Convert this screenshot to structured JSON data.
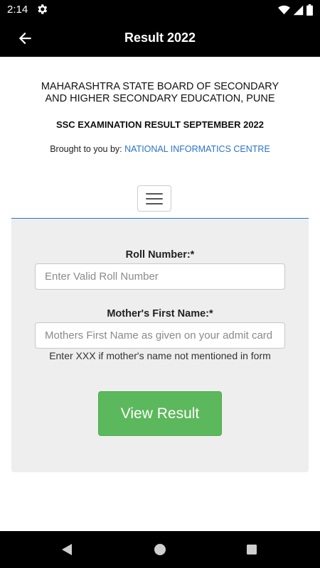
{
  "status_bar": {
    "time": "2:14",
    "icons": [
      "gear-icon",
      "wifi-icon",
      "cellular-signal-icon",
      "battery-icon"
    ]
  },
  "app_bar": {
    "title": "Result 2022",
    "back_icon": "arrow-left-icon"
  },
  "header": {
    "board_line1": "MAHARASHTRA STATE BOARD OF SECONDARY",
    "board_line2": "AND HIGHER SECONDARY EDUCATION, PUNE",
    "exam_title": "SSC EXAMINATION RESULT SEPTEMBER 2022",
    "credit_prefix": "Brought to you by:",
    "credit_link": "NATIONAL INFORMATICS CENTRE"
  },
  "menu": {
    "icon": "hamburger-menu-icon"
  },
  "form": {
    "roll_label": "Roll Number:*",
    "roll_value": "",
    "roll_placeholder": "Enter Valid Roll Number",
    "mother_label": "Mother's First Name:*",
    "mother_value": "",
    "mother_placeholder": "Mothers First Name as given on your admit card",
    "mother_hint": "Enter XXX if mother's name not mentioned in form",
    "submit_label": "View Result"
  },
  "colors": {
    "app_bar": "#000000",
    "link": "#2a73c9",
    "panel": "#eeeeee",
    "submit": "#5cb85c"
  },
  "nav_bar": {
    "icons": [
      "back-triangle-icon",
      "home-circle-icon",
      "recents-square-icon"
    ]
  }
}
